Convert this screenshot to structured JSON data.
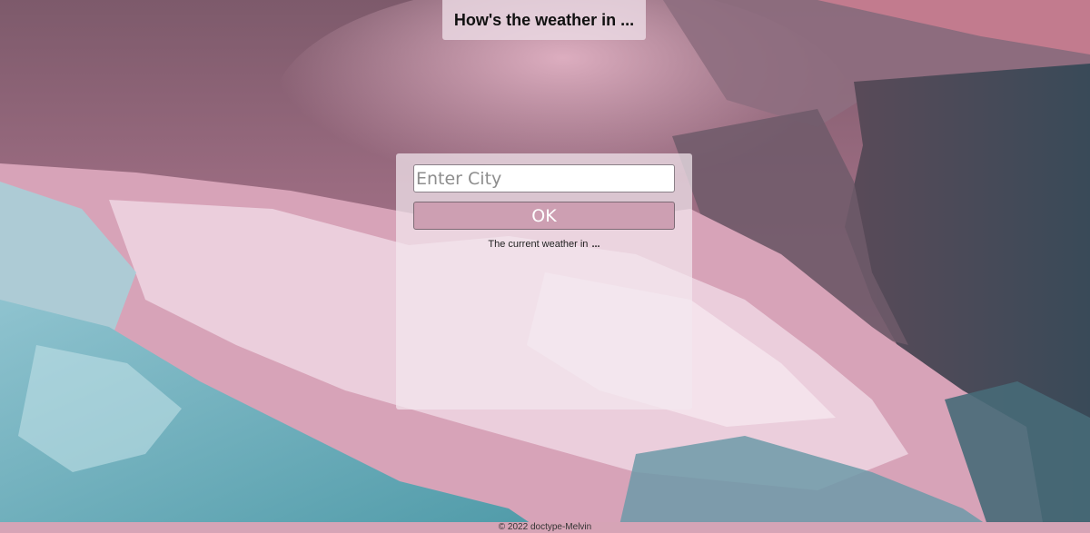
{
  "header": {
    "title": "How's the weather in ..."
  },
  "search": {
    "placeholder": "Enter City",
    "value": "",
    "button_label": "OK"
  },
  "result": {
    "prefix": "The current weather in",
    "city": "..."
  },
  "footer": {
    "text": "© 2022 doctype-Melvin"
  },
  "colors": {
    "footer_bg": "#d6a4b6",
    "button_bg": "#cd9fb2",
    "background_base": "#a36e84"
  }
}
